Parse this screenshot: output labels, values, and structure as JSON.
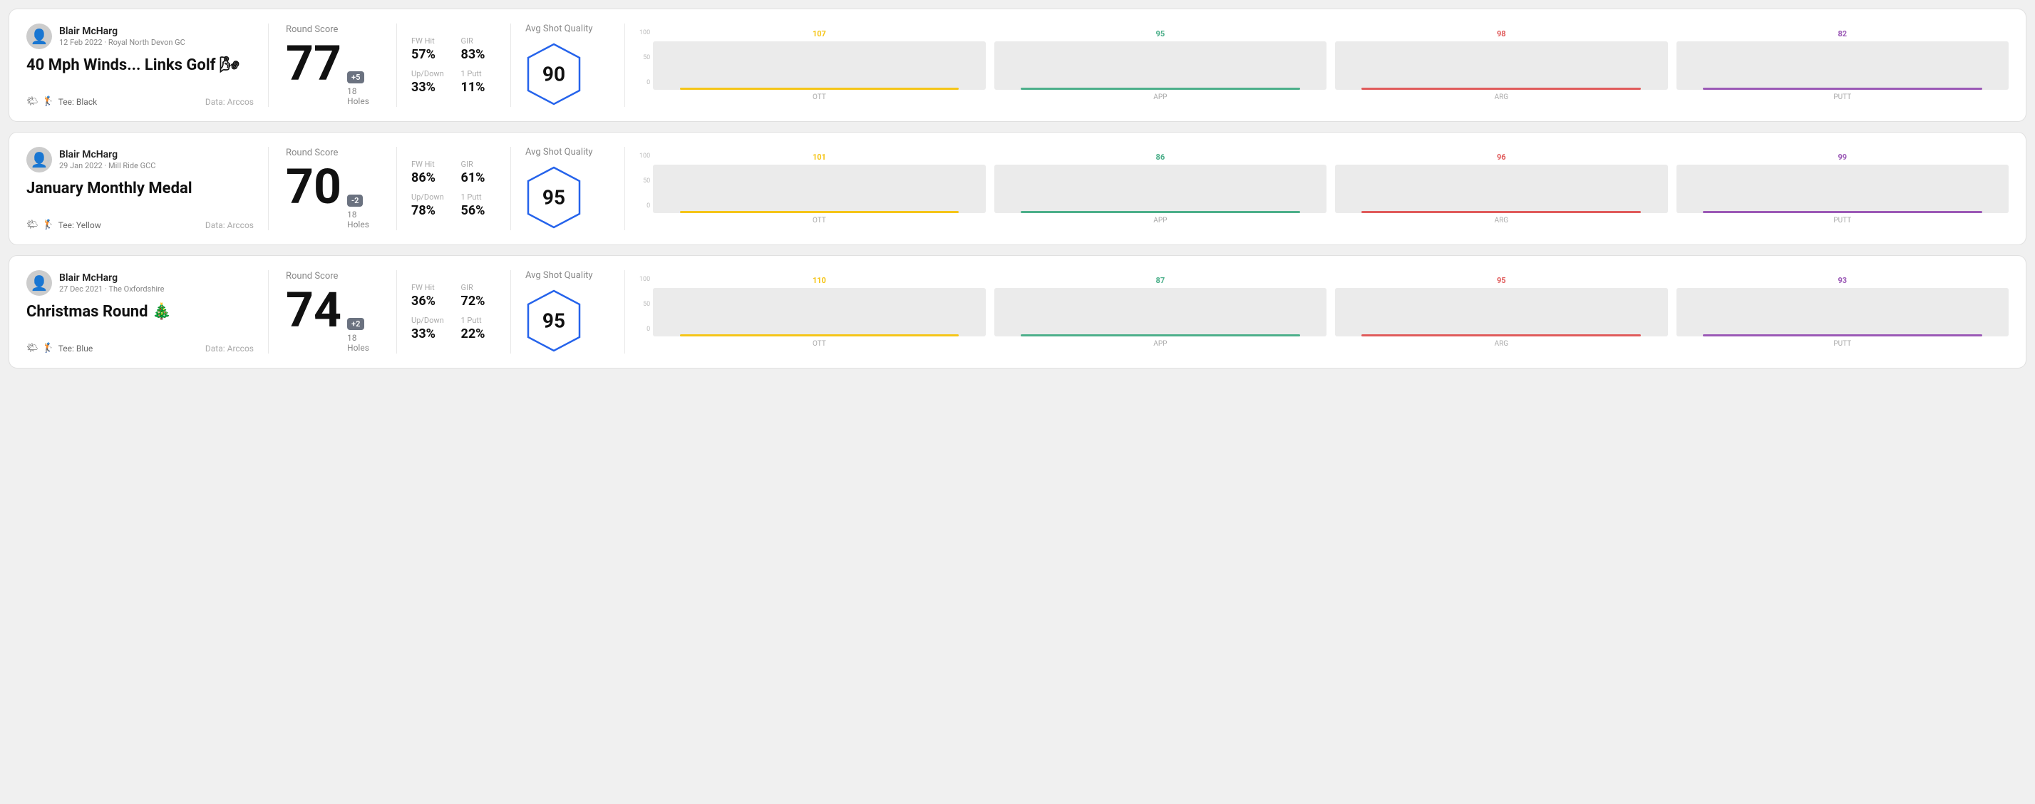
{
  "rounds": [
    {
      "id": "round1",
      "user": {
        "name": "Blair McHarg",
        "meta": "12 Feb 2022 · Royal North Devon GC"
      },
      "title": "40 Mph Winds... Links Golf 🌬",
      "tee": "Tee: Black",
      "data_source": "Data: Arccos",
      "score": {
        "label": "Round Score",
        "number": "77",
        "badge": "+5",
        "holes": "18 Holes"
      },
      "stats": [
        {
          "label": "FW Hit",
          "value": "57%"
        },
        {
          "label": "GIR",
          "value": "83%"
        },
        {
          "label": "Up/Down",
          "value": "33%"
        },
        {
          "label": "1 Putt",
          "value": "11%"
        }
      ],
      "quality": {
        "label": "Avg Shot Quality",
        "score": "90"
      },
      "chart": {
        "bars": [
          {
            "label": "OTT",
            "value": 107,
            "color": "#f5c518",
            "pct": 72
          },
          {
            "label": "APP",
            "value": 95,
            "color": "#4caf8a",
            "pct": 62
          },
          {
            "label": "ARG",
            "value": 98,
            "color": "#e05b5b",
            "pct": 65
          },
          {
            "label": "PUTT",
            "value": 82,
            "color": "#9b59b6",
            "pct": 54
          }
        ],
        "yLabels": [
          "100",
          "50",
          "0"
        ]
      }
    },
    {
      "id": "round2",
      "user": {
        "name": "Blair McHarg",
        "meta": "29 Jan 2022 · Mill Ride GCC"
      },
      "title": "January Monthly Medal",
      "tee": "Tee: Yellow",
      "data_source": "Data: Arccos",
      "score": {
        "label": "Round Score",
        "number": "70",
        "badge": "-2",
        "holes": "18 Holes"
      },
      "stats": [
        {
          "label": "FW Hit",
          "value": "86%"
        },
        {
          "label": "GIR",
          "value": "61%"
        },
        {
          "label": "Up/Down",
          "value": "78%"
        },
        {
          "label": "1 Putt",
          "value": "56%"
        }
      ],
      "quality": {
        "label": "Avg Shot Quality",
        "score": "95"
      },
      "chart": {
        "bars": [
          {
            "label": "OTT",
            "value": 101,
            "color": "#f5c518",
            "pct": 67
          },
          {
            "label": "APP",
            "value": 86,
            "color": "#4caf8a",
            "pct": 57
          },
          {
            "label": "ARG",
            "value": 96,
            "color": "#e05b5b",
            "pct": 64
          },
          {
            "label": "PUTT",
            "value": 99,
            "color": "#9b59b6",
            "pct": 66
          }
        ],
        "yLabels": [
          "100",
          "50",
          "0"
        ]
      }
    },
    {
      "id": "round3",
      "user": {
        "name": "Blair McHarg",
        "meta": "27 Dec 2021 · The Oxfordshire"
      },
      "title": "Christmas Round 🎄",
      "tee": "Tee: Blue",
      "data_source": "Data: Arccos",
      "score": {
        "label": "Round Score",
        "number": "74",
        "badge": "+2",
        "holes": "18 Holes"
      },
      "stats": [
        {
          "label": "FW Hit",
          "value": "36%"
        },
        {
          "label": "GIR",
          "value": "72%"
        },
        {
          "label": "Up/Down",
          "value": "33%"
        },
        {
          "label": "1 Putt",
          "value": "22%"
        }
      ],
      "quality": {
        "label": "Avg Shot Quality",
        "score": "95"
      },
      "chart": {
        "bars": [
          {
            "label": "OTT",
            "value": 110,
            "color": "#f5c518",
            "pct": 73
          },
          {
            "label": "APP",
            "value": 87,
            "color": "#4caf8a",
            "pct": 58
          },
          {
            "label": "ARG",
            "value": 95,
            "color": "#e05b5b",
            "pct": 63
          },
          {
            "label": "PUTT",
            "value": 93,
            "color": "#9b59b6",
            "pct": 62
          }
        ],
        "yLabels": [
          "100",
          "50",
          "0"
        ]
      }
    }
  ]
}
